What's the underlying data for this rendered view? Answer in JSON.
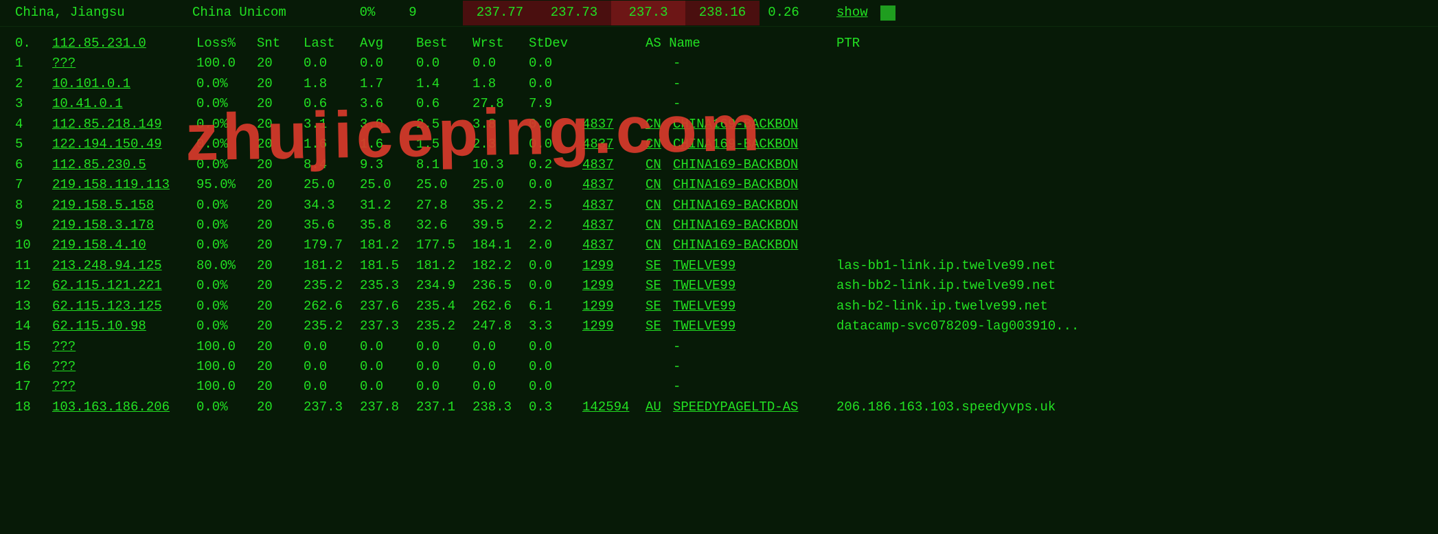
{
  "top": {
    "location": "China, Jiangsu",
    "isp": "China Unicom",
    "pct": "0%",
    "hops": "9",
    "m1": "237.77",
    "m2": "237.73",
    "m3": "237.3",
    "m4": "238.16",
    "m5": "0.26",
    "show_label": "show"
  },
  "headers": {
    "hop": "0.",
    "ip": "112.85.231.0",
    "loss": "Loss%",
    "snt": "Snt",
    "last": "Last",
    "avg": "Avg",
    "best": "Best",
    "wrst": "Wrst",
    "stdev": "StDev",
    "asname": "AS Name",
    "ptr": "PTR"
  },
  "rows": [
    {
      "hop": "1",
      "ip": "???",
      "loss": "100.0",
      "snt": "20",
      "last": "0.0",
      "avg": "0.0",
      "best": "0.0",
      "wrst": "0.0",
      "stdev": "0.0",
      "asn": "",
      "cc": "",
      "asname": "-",
      "ptr": ""
    },
    {
      "hop": "2",
      "ip": "10.101.0.1",
      "loss": "0.0%",
      "snt": "20",
      "last": "1.8",
      "avg": "1.7",
      "best": "1.4",
      "wrst": "1.8",
      "stdev": "0.0",
      "asn": "",
      "cc": "",
      "asname": "-",
      "ptr": ""
    },
    {
      "hop": "3",
      "ip": "10.41.0.1",
      "loss": "0.0%",
      "snt": "20",
      "last": "0.6",
      "avg": "3.6",
      "best": "0.6",
      "wrst": "27.8",
      "stdev": "7.9",
      "asn": "",
      "cc": "",
      "asname": "-",
      "ptr": ""
    },
    {
      "hop": "4",
      "ip": "112.85.218.149",
      "loss": "0.0%",
      "snt": "20",
      "last": "3.1",
      "avg": "3.0",
      "best": "2.5",
      "wrst": "3.8",
      "stdev": "0.0",
      "asn": "4837",
      "cc": "CN",
      "asname": "CHINA169-BACKBON",
      "ptr": ""
    },
    {
      "hop": "5",
      "ip": "122.194.150.49",
      "loss": "0.0%",
      "snt": "20",
      "last": "1.6",
      "avg": "1.6",
      "best": "1.5",
      "wrst": "2.3",
      "stdev": "0.0",
      "asn": "4837",
      "cc": "CN",
      "asname": "CHINA169-BACKBON",
      "ptr": ""
    },
    {
      "hop": "6",
      "ip": "112.85.230.5",
      "loss": "0.0%",
      "snt": "20",
      "last": "8.4",
      "avg": "9.3",
      "best": "8.1",
      "wrst": "10.3",
      "stdev": "0.2",
      "asn": "4837",
      "cc": "CN",
      "asname": "CHINA169-BACKBON",
      "ptr": ""
    },
    {
      "hop": "7",
      "ip": "219.158.119.113",
      "loss": "95.0%",
      "snt": "20",
      "last": "25.0",
      "avg": "25.0",
      "best": "25.0",
      "wrst": "25.0",
      "stdev": "0.0",
      "asn": "4837",
      "cc": "CN",
      "asname": "CHINA169-BACKBON",
      "ptr": ""
    },
    {
      "hop": "8",
      "ip": "219.158.5.158",
      "loss": "0.0%",
      "snt": "20",
      "last": "34.3",
      "avg": "31.2",
      "best": "27.8",
      "wrst": "35.2",
      "stdev": "2.5",
      "asn": "4837",
      "cc": "CN",
      "asname": "CHINA169-BACKBON",
      "ptr": ""
    },
    {
      "hop": "9",
      "ip": "219.158.3.178",
      "loss": "0.0%",
      "snt": "20",
      "last": "35.6",
      "avg": "35.8",
      "best": "32.6",
      "wrst": "39.5",
      "stdev": "2.2",
      "asn": "4837",
      "cc": "CN",
      "asname": "CHINA169-BACKBON",
      "ptr": ""
    },
    {
      "hop": "10",
      "ip": "219.158.4.10",
      "loss": "0.0%",
      "snt": "20",
      "last": "179.7",
      "avg": "181.2",
      "best": "177.5",
      "wrst": "184.1",
      "stdev": "2.0",
      "asn": "4837",
      "cc": "CN",
      "asname": "CHINA169-BACKBON",
      "ptr": ""
    },
    {
      "hop": "11",
      "ip": "213.248.94.125",
      "loss": "80.0%",
      "snt": "20",
      "last": "181.2",
      "avg": "181.5",
      "best": "181.2",
      "wrst": "182.2",
      "stdev": "0.0",
      "asn": "1299",
      "cc": "SE",
      "asname": "TWELVE99",
      "ptr": "las-bb1-link.ip.twelve99.net"
    },
    {
      "hop": "12",
      "ip": "62.115.121.221",
      "loss": "0.0%",
      "snt": "20",
      "last": "235.2",
      "avg": "235.3",
      "best": "234.9",
      "wrst": "236.5",
      "stdev": "0.0",
      "asn": "1299",
      "cc": "SE",
      "asname": "TWELVE99",
      "ptr": "ash-bb2-link.ip.twelve99.net"
    },
    {
      "hop": "13",
      "ip": "62.115.123.125",
      "loss": "0.0%",
      "snt": "20",
      "last": "262.6",
      "avg": "237.6",
      "best": "235.4",
      "wrst": "262.6",
      "stdev": "6.1",
      "asn": "1299",
      "cc": "SE",
      "asname": "TWELVE99",
      "ptr": "ash-b2-link.ip.twelve99.net"
    },
    {
      "hop": "14",
      "ip": "62.115.10.98",
      "loss": "0.0%",
      "snt": "20",
      "last": "235.2",
      "avg": "237.3",
      "best": "235.2",
      "wrst": "247.8",
      "stdev": "3.3",
      "asn": "1299",
      "cc": "SE",
      "asname": "TWELVE99",
      "ptr": "datacamp-svc078209-lag003910..."
    },
    {
      "hop": "15",
      "ip": "???",
      "loss": "100.0",
      "snt": "20",
      "last": "0.0",
      "avg": "0.0",
      "best": "0.0",
      "wrst": "0.0",
      "stdev": "0.0",
      "asn": "",
      "cc": "",
      "asname": "-",
      "ptr": ""
    },
    {
      "hop": "16",
      "ip": "???",
      "loss": "100.0",
      "snt": "20",
      "last": "0.0",
      "avg": "0.0",
      "best": "0.0",
      "wrst": "0.0",
      "stdev": "0.0",
      "asn": "",
      "cc": "",
      "asname": "-",
      "ptr": ""
    },
    {
      "hop": "17",
      "ip": "???",
      "loss": "100.0",
      "snt": "20",
      "last": "0.0",
      "avg": "0.0",
      "best": "0.0",
      "wrst": "0.0",
      "stdev": "0.0",
      "asn": "",
      "cc": "",
      "asname": "-",
      "ptr": ""
    },
    {
      "hop": "18",
      "ip": "103.163.186.206",
      "loss": "0.0%",
      "snt": "20",
      "last": "237.3",
      "avg": "237.8",
      "best": "237.1",
      "wrst": "238.3",
      "stdev": "0.3",
      "asn": "142594",
      "cc": "AU",
      "asname": "SPEEDYPAGELTD-AS",
      "ptr": "206.186.163.103.speedyvps.uk"
    }
  ],
  "watermark": "zhujiceping.com"
}
